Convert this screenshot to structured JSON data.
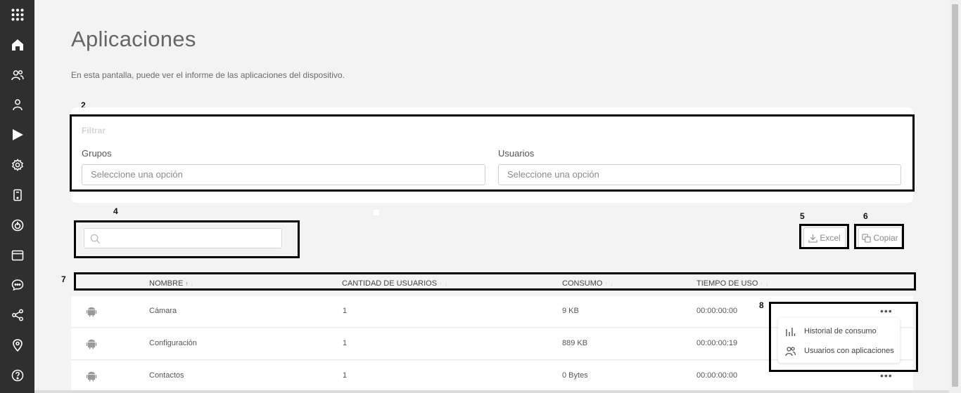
{
  "page": {
    "title": "Aplicaciones",
    "subtitle": "En esta pantalla, puede ver el informe de las aplicaciones del dispositivo."
  },
  "annotations": {
    "n2": "2",
    "n4": "4",
    "n5": "5",
    "n6": "6",
    "n7": "7",
    "n8": "8"
  },
  "filter": {
    "title": "Filtrar",
    "groups_label": "Grupos",
    "groups_placeholder": "Seleccione una opción",
    "users_label": "Usuarios",
    "users_placeholder": "Seleccione una opción"
  },
  "toolbar": {
    "excel_label": "Excel",
    "copy_label": "Copiar"
  },
  "table": {
    "columns": [
      "NOMBRE",
      "CANTIDAD DE USUARIOS",
      "CONSUMO",
      "TIEMPO DE USO"
    ],
    "rows": [
      {
        "name": "Cámara",
        "users": "1",
        "consumption": "9 KB",
        "time": "00:00:00:00"
      },
      {
        "name": "Configuración",
        "users": "1",
        "consumption": "889 KB",
        "time": "00:00:00:19"
      },
      {
        "name": "Contactos",
        "users": "1",
        "consumption": "0 Bytes",
        "time": "00:00:00:00"
      }
    ]
  },
  "row_menu": {
    "items": [
      "Historial de consumo",
      "Usuarios con aplicaciones"
    ]
  },
  "sidebar": {
    "icons": [
      "apps-grid-icon",
      "home-icon",
      "users-icon",
      "user-icon",
      "play-store-icon",
      "settings-gear-icon",
      "device-icon",
      "power-icon",
      "browser-window-icon",
      "chat-icon",
      "share-icon",
      "location-pin-icon",
      "help-icon"
    ]
  }
}
